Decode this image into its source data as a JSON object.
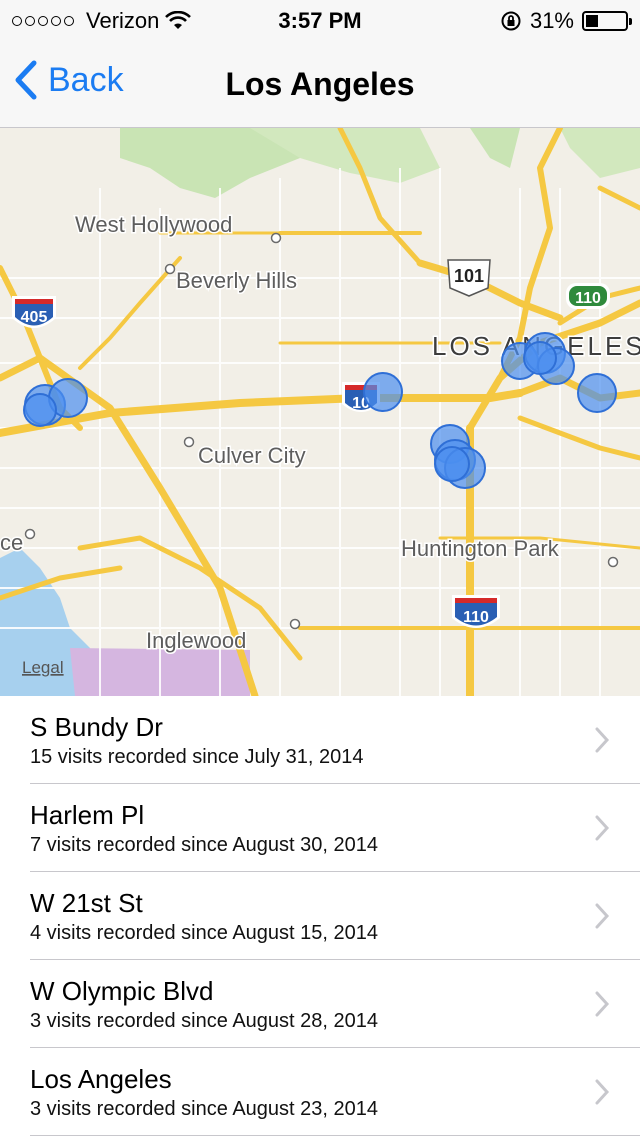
{
  "status": {
    "carrier": "Verizon",
    "time": "3:57 PM",
    "battery": "31%",
    "battery_level": 0.31
  },
  "nav": {
    "back_label": "Back",
    "title": "Los Angeles"
  },
  "map": {
    "labels": {
      "west_hollywood": "West Hollywood",
      "beverly_hills": "Beverly Hills",
      "los_angeles": "LOS ANGELES",
      "culver_city": "Culver City",
      "huntington_park": "Huntington Park",
      "inglewood": "Inglewood",
      "partial_place": "ce",
      "legal": "Legal"
    },
    "shields": {
      "i405": "405",
      "i10": "10",
      "us101": "101",
      "ca110": "110",
      "i110": "110"
    }
  },
  "places": [
    {
      "name": "S Bundy Dr",
      "detail": "15 visits recorded since July 31, 2014"
    },
    {
      "name": "Harlem Pl",
      "detail": "7 visits recorded since August 30, 2014"
    },
    {
      "name": "W 21st St",
      "detail": "4 visits recorded since August 15, 2014"
    },
    {
      "name": "W Olympic Blvd",
      "detail": "3 visits recorded since August 28, 2014"
    },
    {
      "name": "Los Angeles",
      "detail": "3 visits recorded since August 23, 2014"
    }
  ]
}
